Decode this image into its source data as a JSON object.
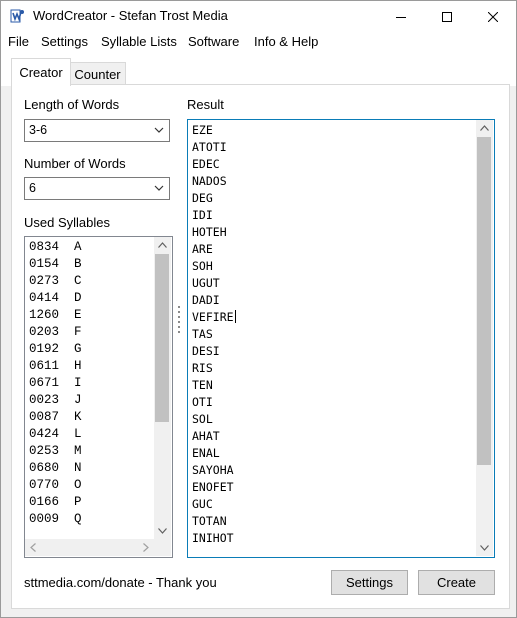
{
  "window": {
    "title": "WordCreator - Stefan Trost Media",
    "icon": "wordcreator-app-icon"
  },
  "menu": [
    "File",
    "Settings",
    "Syllable Lists",
    "Software",
    "Info & Help"
  ],
  "tabs": [
    {
      "label": "Creator",
      "active": true
    },
    {
      "label": "Counter",
      "active": false
    }
  ],
  "creator": {
    "length_label": "Length of Words",
    "length_value": "3-6",
    "number_label": "Number of Words",
    "number_value": "6",
    "syllables_label": "Used Syllables",
    "syllables": [
      {
        "count": "0834",
        "syllable": "A"
      },
      {
        "count": "0154",
        "syllable": "B"
      },
      {
        "count": "0273",
        "syllable": "C"
      },
      {
        "count": "0414",
        "syllable": "D"
      },
      {
        "count": "1260",
        "syllable": "E"
      },
      {
        "count": "0203",
        "syllable": "F"
      },
      {
        "count": "0192",
        "syllable": "G"
      },
      {
        "count": "0611",
        "syllable": "H"
      },
      {
        "count": "0671",
        "syllable": "I"
      },
      {
        "count": "0023",
        "syllable": "J"
      },
      {
        "count": "0087",
        "syllable": "K"
      },
      {
        "count": "0424",
        "syllable": "L"
      },
      {
        "count": "0253",
        "syllable": "M"
      },
      {
        "count": "0680",
        "syllable": "N"
      },
      {
        "count": "0770",
        "syllable": "O"
      },
      {
        "count": "0166",
        "syllable": "P"
      },
      {
        "count": "0009",
        "syllable": "Q"
      }
    ],
    "result_label": "Result",
    "results": [
      "EZE",
      "ATOTI",
      "EDEC",
      "NADOS",
      "DEG",
      "IDI",
      "HOTEH",
      "ARE",
      "SOH",
      "UGUT",
      "DADI",
      "VEFIRE",
      "TAS",
      "DESI",
      "RIS",
      "TEN",
      "OTI",
      "SOL",
      "AHAT",
      "ENAL",
      "SAYOHA",
      "ENOFET",
      "GUC",
      "TOTAN",
      "INIHOT"
    ],
    "caret_line": 11
  },
  "footer": {
    "donate_text": "sttmedia.com/donate - Thank you",
    "settings_button": "Settings",
    "create_button": "Create"
  }
}
